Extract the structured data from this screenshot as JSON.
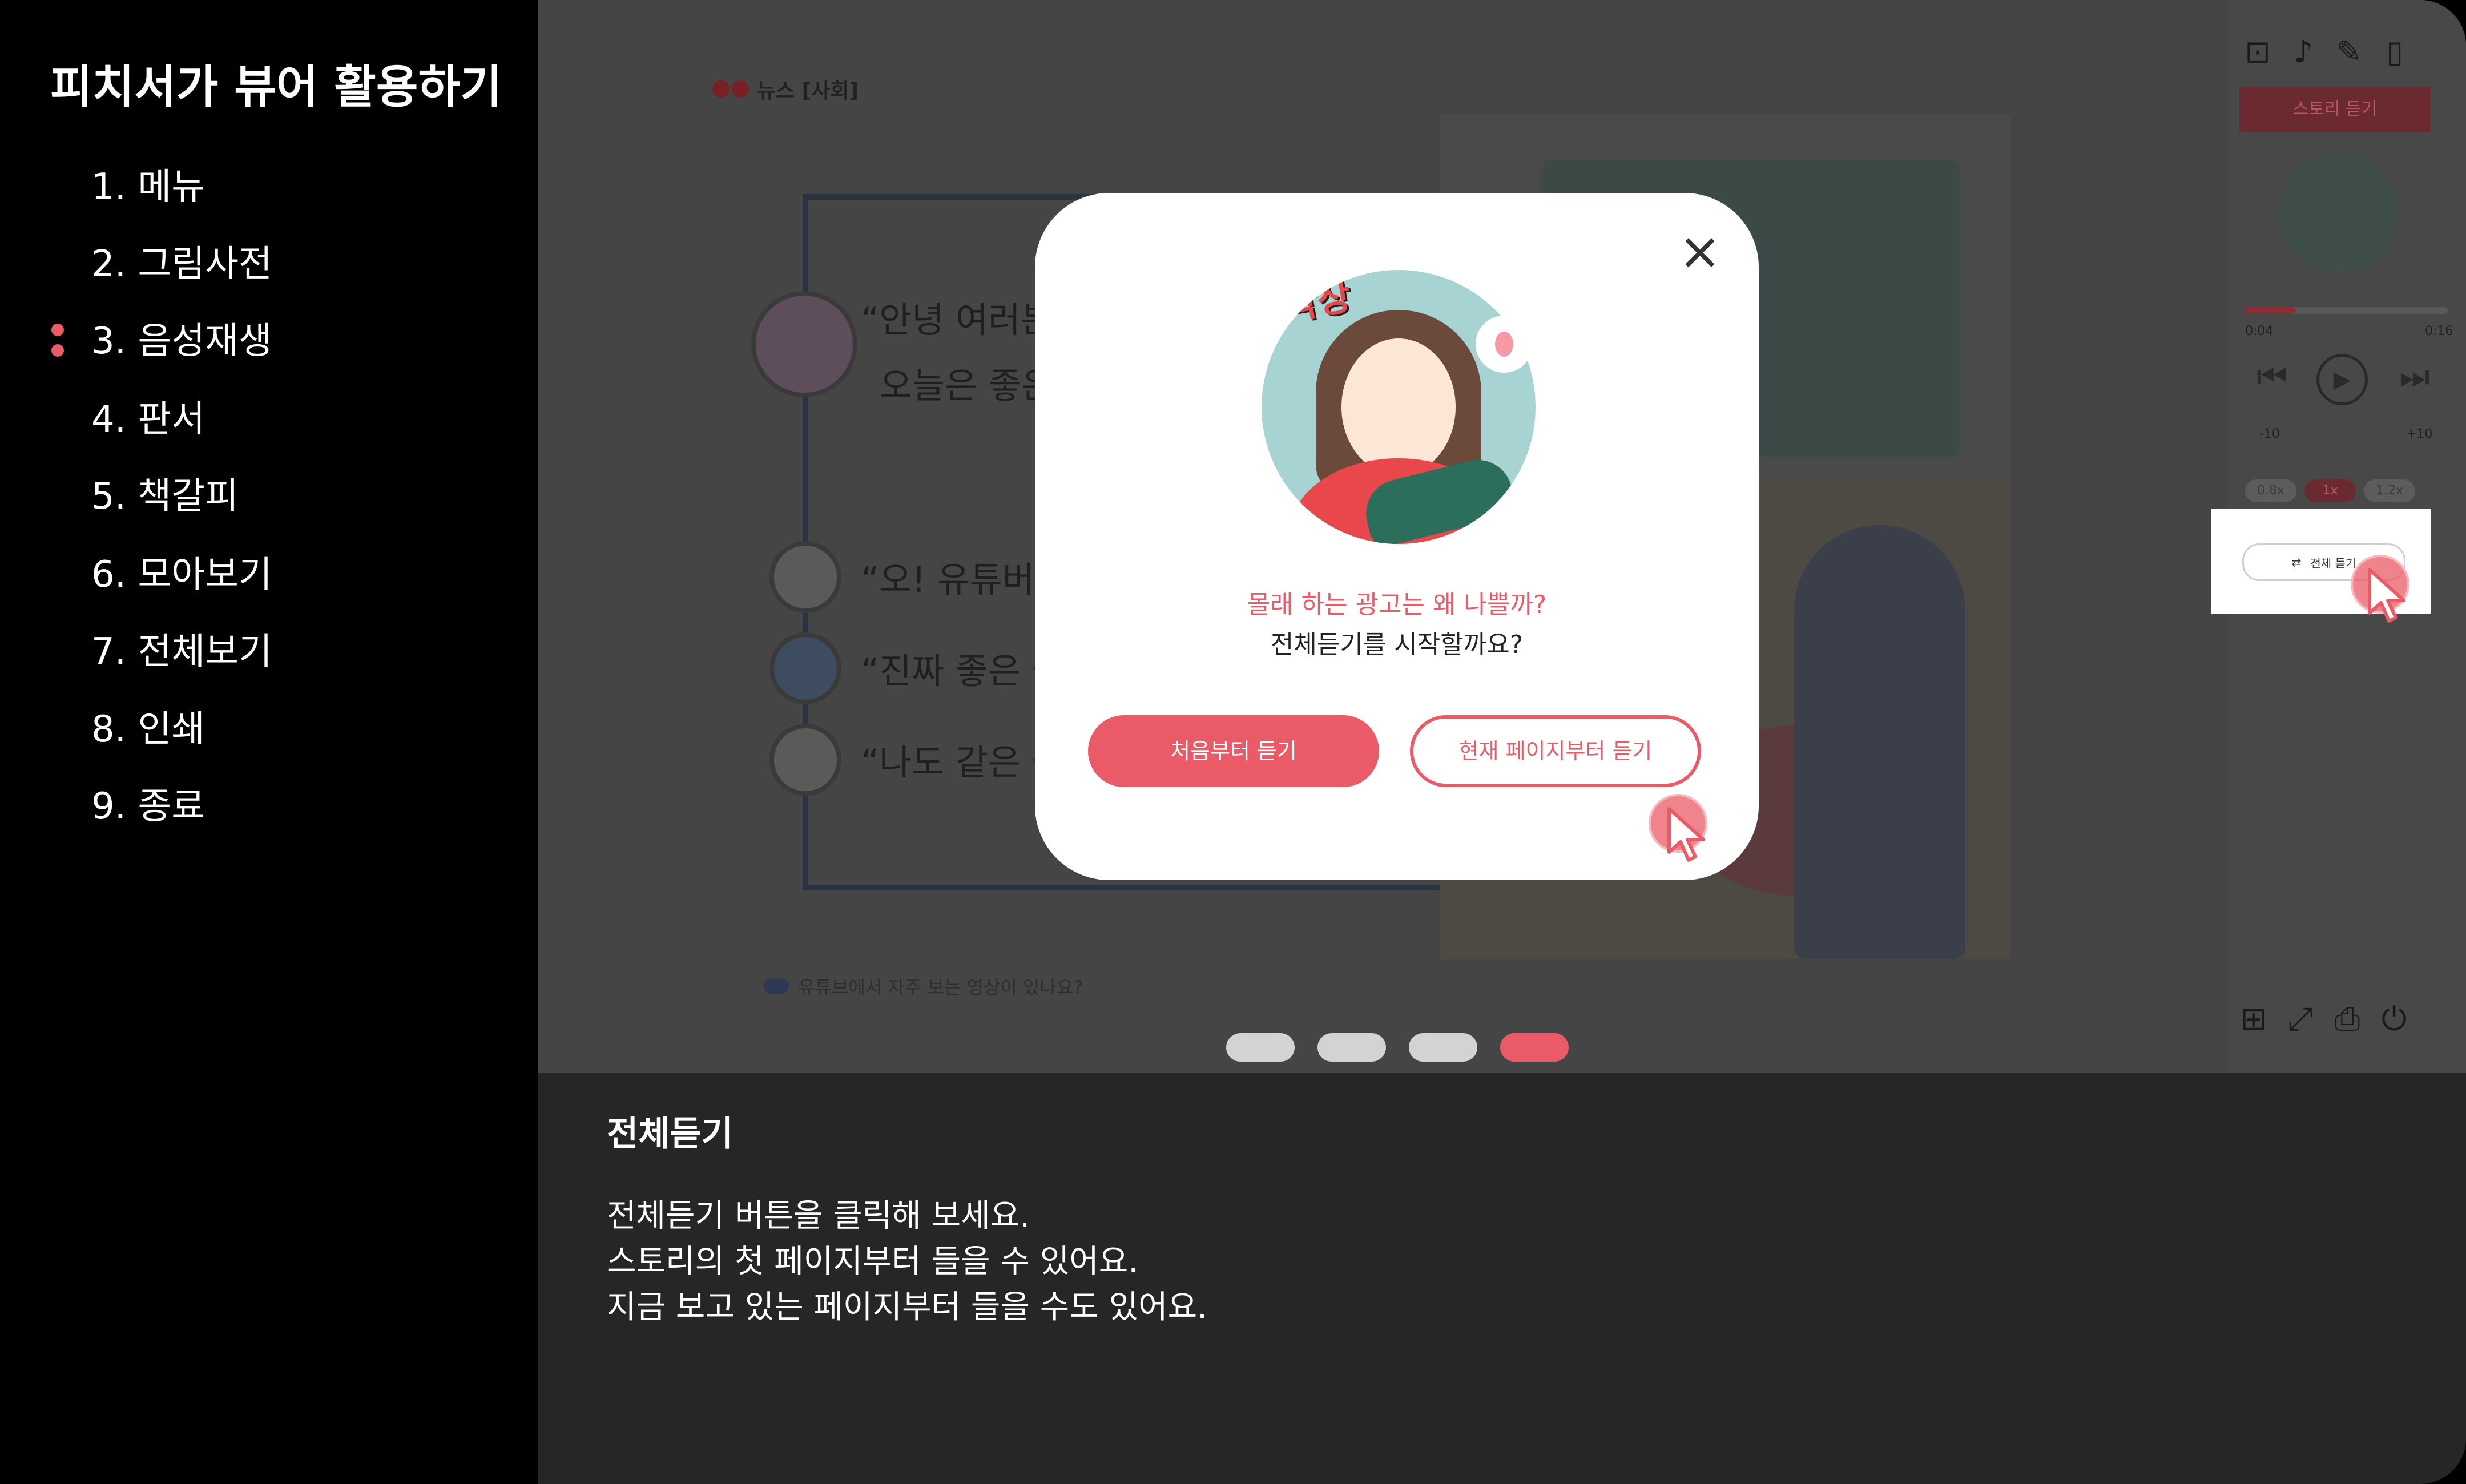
{
  "sidebar": {
    "title": "피치서가 뷰어 활용하기",
    "items": [
      {
        "label": "1. 메뉴"
      },
      {
        "label": "2. 그림사전"
      },
      {
        "label": "3. 음성재생",
        "active": true
      },
      {
        "label": "4. 판서"
      },
      {
        "label": "5. 책갈피"
      },
      {
        "label": "6. 모아보기"
      },
      {
        "label": "7. 전체보기"
      },
      {
        "label": "8. 인쇄"
      },
      {
        "label": "9. 종료"
      }
    ],
    "active_color": "#ea5b67"
  },
  "viewer": {
    "news_tag": "뉴스 [사회]",
    "chat_lines": [
      "“안녕 여러분",
      "오늘은 좋은",
      "“오! 유튜버 한",
      "“진짜 좋은 물",
      "“나도 같은 물"
    ],
    "caption": "유튜브에서 자주 보는 영상이 있나요?",
    "page_dots": [
      {
        "active": false
      },
      {
        "active": false
      },
      {
        "active": false
      },
      {
        "active": true
      }
    ]
  },
  "right_panel": {
    "icons": [
      "word-dictionary-icon",
      "speaker-icon",
      "pen-icon",
      "bookmark-icon"
    ],
    "story_listen_label": "스토리 듣기",
    "time_current": "0:04",
    "time_total": "0:16",
    "progress": 0.25,
    "skip_back_label": "-10",
    "skip_forward_label": "+10",
    "speeds": [
      {
        "label": "0.8x",
        "active": false
      },
      {
        "label": "1x",
        "active": true
      },
      {
        "label": "1.2x",
        "active": false
      }
    ],
    "listen_all_label": "전체 듣기",
    "bottom_icons": [
      "grid-view-icon",
      "fullscreen-icon",
      "print-icon",
      "power-icon"
    ]
  },
  "modal": {
    "sign_text": "대박상",
    "title": "몰래 하는 광고는 왜 나쁠까?",
    "question": "전체듣기를 시작할까요?",
    "btn_from_start": "처음부터 듣기",
    "btn_from_current": "현재 페이지부터 듣기",
    "close_symbol": "×"
  },
  "description": {
    "title": "전체듣기",
    "lines": [
      "전체듣기 버튼을 클릭해 보세요.",
      "스토리의 첫 페이지부터 들을 수 있어요.",
      "지금 보고 있는 페이지부터 들을 수도 있어요."
    ]
  },
  "colors": {
    "accent": "#ea5b67",
    "background": "#000000",
    "overlay": "#434343",
    "description_bg": "#262626"
  }
}
